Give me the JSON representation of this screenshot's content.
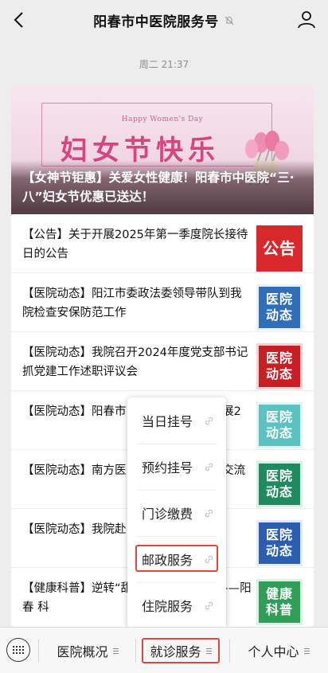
{
  "header": {
    "title": "阳春市中医院服务号"
  },
  "timestamp": "周二 21:37",
  "banner": {
    "subtitle": "Happy Women's Day",
    "headline": "妇女节快乐",
    "caption": "【女神节钜惠】关爱女性健康！阳春市中医院“三·八”妇女节优惠已送达！"
  },
  "articles": [
    {
      "title": "【公告】关于开展2025年第一季度院长接待日的公告",
      "thumb": [
        "公告"
      ]
    },
    {
      "title": "【医院动态】阳江市委政法委领导带队到我院检查安保防范工作",
      "thumb": [
        "医院",
        "动态"
      ]
    },
    {
      "title": "【医院动态】我院召开2024年度党支部书记抓党建工作述职评议会",
      "thumb": [
        "医院",
        "动态"
      ]
    },
    {
      "title": "【医院动态】阳春市        院到各成员单位开展2        ",
      "thumb": [
        "医院",
        "动态"
      ]
    },
    {
      "title": "【医院动态】南方医        院组团到我院调研交流",
      "thumb": [
        "医院",
        "动态"
      ]
    },
    {
      "title": "【医院动态】我院赴        治疗医院参观学习",
      "thumb": [
        "医院",
        "动态"
      ]
    },
    {
      "title": "【健康科普】逆转“甜        病，重回健康态——阳春        科",
      "thumb": [
        "健康",
        "科普"
      ]
    }
  ],
  "popup_menu": {
    "items": [
      "当日挂号",
      "预约挂号",
      "门诊缴费",
      "邮政服务",
      "住院服务"
    ],
    "highlighted": "邮政服务"
  },
  "bottom_menu": {
    "tabs": [
      "医院概况",
      "就诊服务",
      "个人中心"
    ],
    "active": "就诊服务"
  }
}
